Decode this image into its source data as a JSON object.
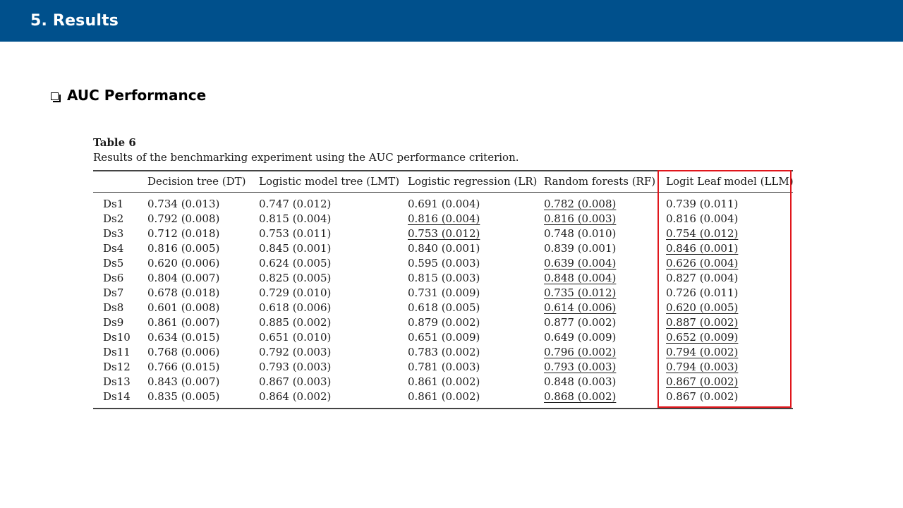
{
  "header": {
    "title": "5. Results"
  },
  "section": {
    "bullet_text": "AUC Performance"
  },
  "table": {
    "label": "Table 6",
    "caption": "Results of the benchmarking experiment using the AUC performance criterion.",
    "columns": [
      "",
      "Decision tree (DT)",
      "Logistic model tree (LMT)",
      "Logistic regression (LR)",
      "Random forests (RF)",
      "Logit Leaf model (LLM)"
    ],
    "rows": [
      [
        "Ds1",
        "0.734 (0.013)",
        "0.747 (0.012)",
        "0.691 (0.004)",
        "0.782 (0.008)",
        "0.739 (0.011)"
      ],
      [
        "Ds2",
        "0.792 (0.008)",
        "0.815 (0.004)",
        "0.816 (0.004)",
        "0.816 (0.003)",
        "0.816 (0.004)"
      ],
      [
        "Ds3",
        "0.712 (0.018)",
        "0.753 (0.011)",
        "0.753 (0.012)",
        "0.748 (0.010)",
        "0.754 (0.012)"
      ],
      [
        "Ds4",
        "0.816 (0.005)",
        "0.845 (0.001)",
        "0.840 (0.001)",
        "0.839 (0.001)",
        "0.846 (0.001)"
      ],
      [
        "Ds5",
        "0.620 (0.006)",
        "0.624 (0.005)",
        "0.595 (0.003)",
        "0.639 (0.004)",
        "0.626 (0.004)"
      ],
      [
        "Ds6",
        "0.804 (0.007)",
        "0.825 (0.005)",
        "0.815 (0.003)",
        "0.848 (0.004)",
        "0.827 (0.004)"
      ],
      [
        "Ds7",
        "0.678 (0.018)",
        "0.729 (0.010)",
        "0.731 (0.009)",
        "0.735 (0.012)",
        "0.726 (0.011)"
      ],
      [
        "Ds8",
        "0.601 (0.008)",
        "0.618 (0.006)",
        "0.618 (0.005)",
        "0.614 (0.006)",
        "0.620 (0.005)"
      ],
      [
        "Ds9",
        "0.861 (0.007)",
        "0.885 (0.002)",
        "0.879 (0.002)",
        "0.877 (0.002)",
        "0.887 (0.002)"
      ],
      [
        "Ds10",
        "0.634 (0.015)",
        "0.651 (0.010)",
        "0.651 (0.009)",
        "0.649 (0.009)",
        "0.652 (0.009)"
      ],
      [
        "Ds11",
        "0.768 (0.006)",
        "0.792 (0.003)",
        "0.783 (0.002)",
        "0.796 (0.002)",
        "0.794 (0.002)"
      ],
      [
        "Ds12",
        "0.766 (0.015)",
        "0.793 (0.003)",
        "0.781 (0.003)",
        "0.793 (0.003)",
        "0.794 (0.003)"
      ],
      [
        "Ds13",
        "0.843 (0.007)",
        "0.867 (0.003)",
        "0.861 (0.002)",
        "0.848 (0.003)",
        "0.867 (0.002)"
      ],
      [
        "Ds14",
        "0.835 (0.005)",
        "0.864 (0.002)",
        "0.861 (0.002)",
        "0.868 (0.002)",
        "0.867 (0.002)"
      ]
    ],
    "underlined": [
      [
        0,
        4
      ],
      [
        1,
        3
      ],
      [
        1,
        4
      ],
      [
        2,
        3
      ],
      [
        2,
        5
      ],
      [
        3,
        5
      ],
      [
        4,
        4
      ],
      [
        4,
        5
      ],
      [
        5,
        4
      ],
      [
        6,
        4
      ],
      [
        7,
        4
      ],
      [
        7,
        5
      ],
      [
        8,
        5
      ],
      [
        9,
        5
      ],
      [
        10,
        4
      ],
      [
        10,
        5
      ],
      [
        11,
        4
      ],
      [
        11,
        5
      ],
      [
        12,
        5
      ],
      [
        13,
        4
      ]
    ],
    "highlighted_column": "Logit Leaf model (LLM)"
  },
  "colors": {
    "header_bg": "#00508c",
    "header_text": "#ffffff",
    "highlight_border": "#e0161c"
  }
}
